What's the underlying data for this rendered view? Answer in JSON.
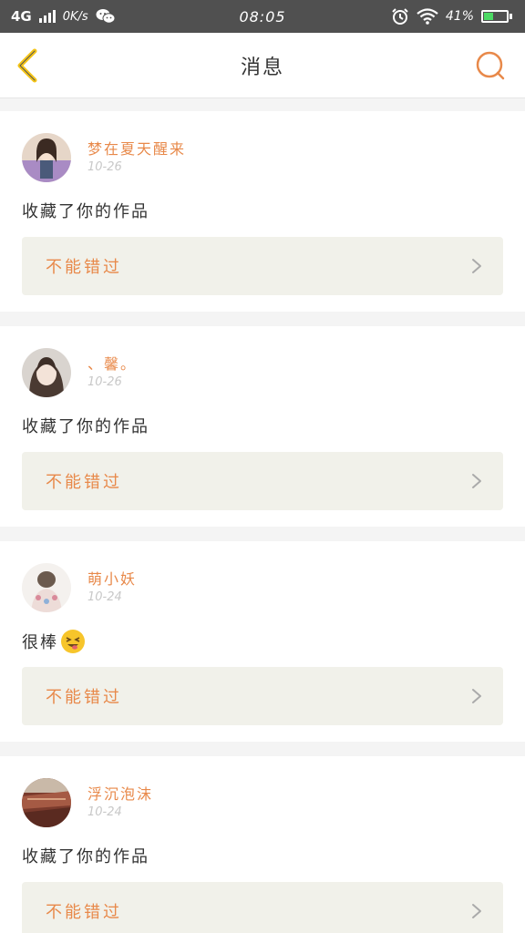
{
  "status_bar": {
    "network": "4G",
    "speed": "0K/s",
    "time": "08:05",
    "battery_pct": "41%",
    "battery_level": 0.41,
    "icons": [
      "signal-icon",
      "wechat-icon",
      "alarm-icon",
      "wifi-icon",
      "battery-icon"
    ]
  },
  "header": {
    "title": "消息",
    "back_icon": "chevron-left-icon",
    "search_icon": "search-icon",
    "accent": "#e8894a",
    "back_color": "#f5c518"
  },
  "messages": [
    {
      "username": "梦在夏天醒来",
      "date": "10-26",
      "text": "收藏了你的作品",
      "emoji": "",
      "work_title": "不能错过",
      "avatar": "avatar-girl-cartoon"
    },
    {
      "username": "、馨。",
      "date": "10-26",
      "text": "收藏了你的作品",
      "emoji": "",
      "work_title": "不能错过",
      "avatar": "avatar-girl-photo"
    },
    {
      "username": "萌小妖",
      "date": "10-24",
      "text": "很棒",
      "emoji": "grinning-tongue-emoji",
      "work_title": "不能错过",
      "avatar": "avatar-hair-back"
    },
    {
      "username": "浮沉泡沫",
      "date": "10-24",
      "text": "收藏了你的作品",
      "emoji": "",
      "work_title": "不能错过",
      "avatar": "avatar-landscape"
    }
  ]
}
